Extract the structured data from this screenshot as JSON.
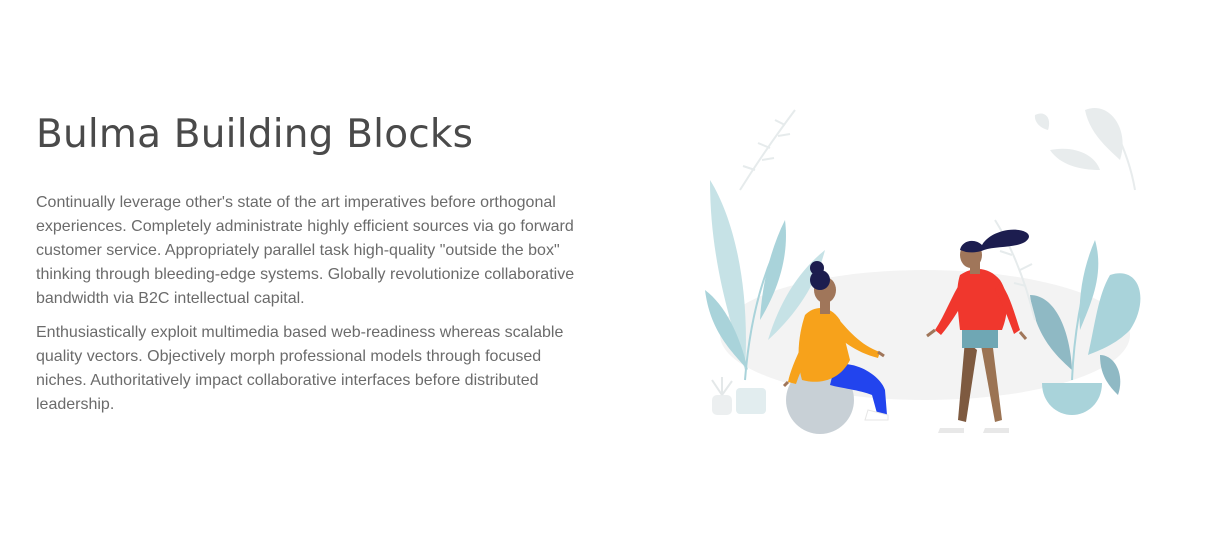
{
  "section": {
    "title": "Bulma Building Blocks",
    "paragraphs": [
      "Continually leverage other's state of the art imperatives before orthogonal experiences. Completely administrate highly efficient sources via go forward customer service. Appropriately parallel task high-quality \"outside the box\" thinking through bleeding-edge systems. Globally revolutionize collaborative bandwidth via B2C intellectual capital.",
      "Enthusiastically exploit multimedia based web-readiness whereas scalable quality vectors. Objectively morph professional models through focused niches. Authoritatively impact collaborative interfaces before distributed leadership."
    ]
  },
  "illustration": {
    "icon": "people-with-plants-illustration",
    "colors": {
      "plant": "#a9d3da",
      "plant_light": "#c6e2e6",
      "leaf_faint": "#e6ebec",
      "blob": "#f3f3f3",
      "ball": "#c8d0d6",
      "hoodie": "#f7a21b",
      "pants": "#2244ee",
      "sweater": "#f0372d",
      "hair": "#1c1d4f",
      "skin": "#a0765a",
      "trousers": "#9b7353"
    }
  }
}
